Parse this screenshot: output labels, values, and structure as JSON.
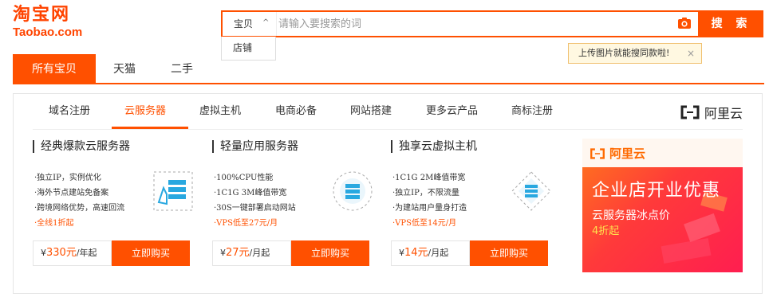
{
  "logo": {
    "cn": "淘宝网",
    "en": "Taobao.com"
  },
  "search": {
    "scope": "宝贝",
    "placeholder": "请输入要搜索的词",
    "button": "搜 索",
    "dropdown_option": "店铺",
    "tip": "上传图片就能搜同款啦!",
    "tip_close": "×"
  },
  "main_tabs": [
    "所有宝贝",
    "天猫",
    "二手"
  ],
  "subnav": [
    "域名注册",
    "云服务器",
    "虚拟主机",
    "电商必备",
    "网站搭建",
    "更多云产品",
    "商标注册"
  ],
  "aliyun_label": "阿里云",
  "cards": [
    {
      "title": "经典爆款云服务器",
      "features": [
        "·独立IP，实例优化",
        "·海外节点建站免备案",
        "·跨境网络优势，高速回流"
      ],
      "promo": "·全线1折起",
      "price": "330元",
      "unit": "/年起",
      "buy": "立即购买"
    },
    {
      "title": "轻量应用服务器",
      "features": [
        "·100%CPU性能",
        "·1C1G 3M峰值带宽",
        "·30S一键部署启动网站"
      ],
      "promo": "·VPS低至27元/月",
      "price": "27元",
      "unit": "/月起",
      "buy": "立即购买"
    },
    {
      "title": "独享云虚拟主机",
      "features": [
        "·1C1G 2M峰值带宽",
        "·独立IP，不限流量",
        "·为建站用户量身打造"
      ],
      "promo": "·VPS低至14元/月",
      "price": "14元",
      "unit": "/月起",
      "buy": "立即购买"
    }
  ],
  "currency": "¥",
  "banner": {
    "logo": "阿里云",
    "headline": "企业店开业优惠",
    "sub": "云服务器冰点价",
    "discount": "4折起"
  },
  "colors": {
    "accent": "#ff5000"
  }
}
